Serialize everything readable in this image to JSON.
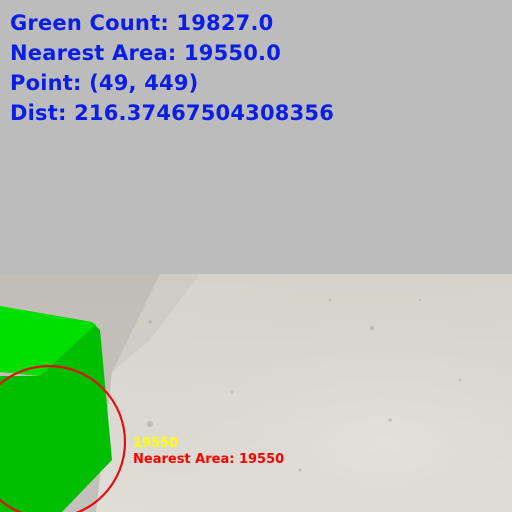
{
  "hud": {
    "green_count": "Green Count: 19827.0",
    "nearest_area": "Nearest Area: 19550.0",
    "point": "Point: (49, 449)",
    "dist": "Dist: 216.37467504308356"
  },
  "overlay": {
    "area_value": "19550",
    "nearest_area_label": "Nearest Area: 19550"
  },
  "colors": {
    "hud_text": "#0a1ee6",
    "area_value_text": "#ffff00",
    "nearest_label_text": "#ff0000",
    "detection_circle": "#e01010",
    "cube_front": "#00c800",
    "cube_side": "#00dc00",
    "sky": "#bcbcbc",
    "floor": "#d8d6cf"
  }
}
